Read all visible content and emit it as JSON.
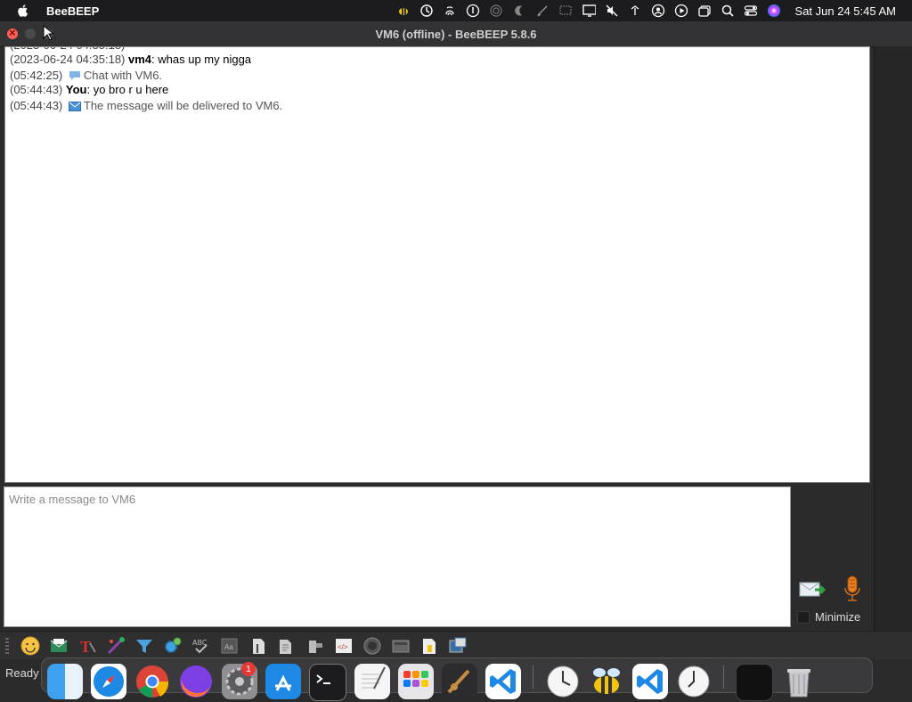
{
  "menubar": {
    "app_name": "BeeBEEP",
    "clock": "Sat Jun 24  5:45 AM",
    "status_icons": [
      "bee-icon",
      "time-machine-icon",
      "fingerprint-icon",
      "accessibility-icon",
      "airdrop-icon",
      "focus-moon-icon",
      "pen-off-icon",
      "screen-mirror-icon",
      "display-icon",
      "mute-icon",
      "wifi-off-icon",
      "user-icon",
      "play-icon",
      "window-icon",
      "search-icon",
      "control-center-icon",
      "siri-icon"
    ]
  },
  "window": {
    "title": "VM6 (offline) - BeeBEEP 5.8.6"
  },
  "chat": {
    "lines": [
      {
        "ts": "(2023-06-24 04:35:18)",
        "who": "vm4",
        "text": ": whas up my nigga",
        "kind": "msg"
      },
      {
        "ts": "(05:42:25)",
        "who": "",
        "text": "Chat with VM6.",
        "kind": "sys",
        "icon": "chat-bubble-icon"
      },
      {
        "ts": "(05:44:43)",
        "who": "You",
        "text": ": yo bro r u here",
        "kind": "msg"
      },
      {
        "ts": "(05:44:43)",
        "who": "",
        "text": "The message will be delivered to VM6.",
        "kind": "sys",
        "icon": "envelope-icon"
      }
    ]
  },
  "input": {
    "placeholder": "Write a message to VM6",
    "value": ""
  },
  "actions": {
    "minimize_label": "Minimize"
  },
  "toolbar": {
    "buttons": [
      "emoji-icon",
      "save-chat-icon",
      "font-icon",
      "color-picker-icon",
      "filter-icon",
      "settings-gear-icon",
      "spellcheck-icon",
      "font-size-icon",
      "send-file-icon",
      "send-folder-icon",
      "share-icon",
      "code-icon",
      "screenshot-icon",
      "folder-open-icon",
      "clear-chat-icon",
      "window-detach-icon"
    ]
  },
  "status": {
    "text": "Ready"
  },
  "dock": {
    "apps": [
      "finder",
      "safari",
      "chrome",
      "firefox",
      "system-settings",
      "app-store",
      "terminal",
      "textedit",
      "launchpad",
      "music-editor",
      "vscode"
    ],
    "recent": [
      "clock",
      "beebeep",
      "vscode",
      "clock2"
    ],
    "right": [
      "screen",
      "trash"
    ],
    "settings_badge": "1"
  },
  "colors": {
    "chat_bg": "#ffffff",
    "window_bg": "#2b2b2b",
    "close_red": "#ff5f57",
    "accent_blue": "#1e88e5"
  }
}
